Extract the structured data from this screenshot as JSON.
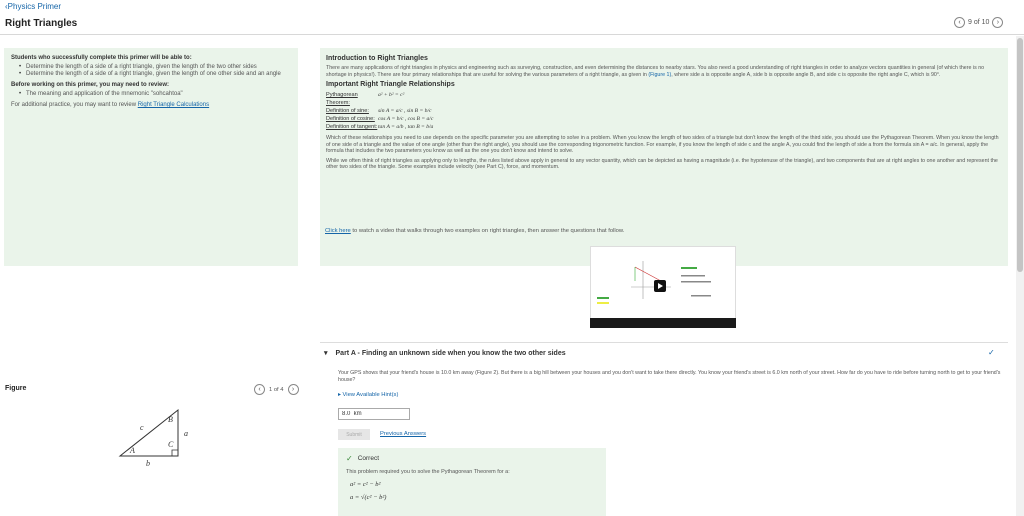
{
  "header": {
    "back_link": "Physics Primer",
    "title": "Right Triangles",
    "pager": "9 of 10"
  },
  "objectives": {
    "heading": "Students who successfully complete this primer will be able to:",
    "items": [
      "Determine the length of a side of a right triangle, given the length of the two other sides",
      "Determine the length of a side of a right triangle, given the length of one other side and an angle"
    ],
    "review_heading": "Before working on this primer, you may need to review:",
    "review_items": [
      "The meaning and application of the mnemonic \"sohcahtoa\""
    ],
    "practice_text": "For additional practice, you may want to review ",
    "practice_link": "Right Triangle Calculations"
  },
  "intro": {
    "title": "Introduction to Right Triangles",
    "para1": "There are many applications of right triangles in physics and engineering such as surveying, construction, and even determining the distances to nearby stars. You also need a good understanding of right triangles in order to analyze vectors quantities in general (of which there is no shortage in physics!). There are four primary relationships that are useful for solving the various parameters of a right triangle, as given in",
    "para1_link": "(Figure 1)",
    "para1_end": ", where side a is opposite angle A, side b is opposite angle B, and side c is opposite the right angle C, which is 90°.",
    "rel_title": "Important Right Triangle Relationships",
    "definitions": [
      {
        "label": "Pythagorean Theorem:",
        "formula": "a² + b² = c²"
      },
      {
        "label": "Definition of sine:",
        "formula": "sin A = a/c , sin B = b/c"
      },
      {
        "label": "Definition of cosine:",
        "formula": "cos A = b/c , cos B = a/c"
      },
      {
        "label": "Definition of tangent:",
        "formula": "tan A = a/b , tan B = b/a"
      }
    ],
    "para2": "Which of these relationships you need to use depends on the specific parameter you are attempting to solve in a problem. When you know the length of two sides of a triangle but don't know the length of the third side, you should use the Pythagorean Theorem. When you know the length of one side of a triangle and the value of one angle (other than the right angle), you should use the corresponding trigonometric function. For example, if you know the length of side c and the angle A, you could find the length of side a from the formula sin A = a/c. In general, apply the formula that includes the two parameters you know as well as the one you don't know and intend to solve.",
    "para3": "While we often think of right triangles as applying only to lengths, the rules listed above apply in general to any vector quantity, which can be depicted as having a magnitude (i.e. the hypotenuse of the triangle), and two components that are at right angles to one another and represent the other two sides of the triangle. Some examples include velocity (see Part C), force, and momentum."
  },
  "video": {
    "link": "Click here",
    "text": " to watch a video that walks through two examples on right triangles, then answer the questions that follow."
  },
  "part_a": {
    "title": "Part A - Finding an unknown side when you know the two other sides",
    "text": "Your GPS shows that your friend's house is 10.0 km away (Figure 2). But there is a big hill between your houses and you don't want to take there directly. You know your friend's street is 6.0 km north of your street. How far do you have to ride before turning north to get to your friend's house?",
    "hints": "View Available Hint(s)",
    "answer_value": "8.0  km",
    "submit": "Submit",
    "previous": "Previous Answers",
    "correct_label": "Correct",
    "correct_text": "This problem required you to solve the Pythagorean Theorem for a:",
    "eq1": "a² = c² − b²",
    "eq2": "a = √(c² − b²)"
  },
  "figure": {
    "label": "Figure",
    "pager": "1 of 4",
    "labels": {
      "c": "c",
      "a": "a",
      "b": "b",
      "A": "A",
      "B": "B",
      "C": "C"
    }
  },
  "colors": {
    "panel_bg": "#eaf4ea",
    "link": "#1565a8",
    "correct": "#3a8a3a"
  }
}
